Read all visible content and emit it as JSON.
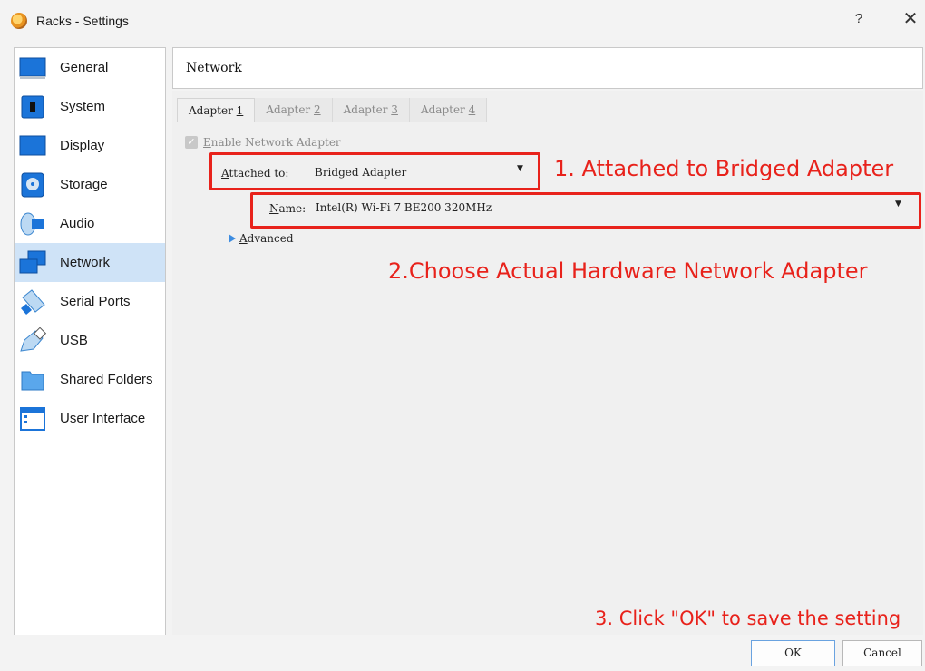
{
  "window": {
    "title": "Racks - Settings",
    "help_glyph": "?",
    "close_glyph": "✕"
  },
  "sidebar": {
    "items": [
      {
        "label": "General",
        "icon": "general-monitor-icon"
      },
      {
        "label": "System",
        "icon": "system-chip-icon"
      },
      {
        "label": "Display",
        "icon": "display-monitor-icon"
      },
      {
        "label": "Storage",
        "icon": "storage-disk-icon"
      },
      {
        "label": "Audio",
        "icon": "audio-speaker-icon"
      },
      {
        "label": "Network",
        "icon": "network-icon",
        "selected": true
      },
      {
        "label": "Serial Ports",
        "icon": "serial-port-icon"
      },
      {
        "label": "USB",
        "icon": "usb-plug-icon"
      },
      {
        "label": "Shared Folders",
        "icon": "shared-folder-icon"
      },
      {
        "label": "User Interface",
        "icon": "user-interface-icon"
      }
    ]
  },
  "panel": {
    "title": "Network",
    "tabs": [
      {
        "label": "Adapter ",
        "key": "1",
        "active": true
      },
      {
        "label": "Adapter ",
        "key": "2"
      },
      {
        "label": "Adapter ",
        "key": "3"
      },
      {
        "label": "Adapter ",
        "key": "4"
      }
    ],
    "enable_checkbox": {
      "label_prefix": "E",
      "label_rest": "nable Network Adapter",
      "checked": true
    },
    "attached_to": {
      "label_prefix": "A",
      "label_rest": "ttached to:",
      "value": "Bridged Adapter"
    },
    "name_field": {
      "label_prefix": "N",
      "label_rest": "ame:",
      "value": "Intel(R) Wi-Fi 7 BE200 320MHz"
    },
    "advanced": {
      "label_prefix": "A",
      "label_rest": "dvanced"
    }
  },
  "annotations": {
    "step1": "1. Attached to Bridged Adapter",
    "step2": "2.Choose Actual Hardware Network Adapter",
    "step3": "3. Click \"OK\" to save the setting",
    "color": "#e8221b"
  },
  "buttons": {
    "ok": "OK",
    "cancel": "Cancel"
  }
}
